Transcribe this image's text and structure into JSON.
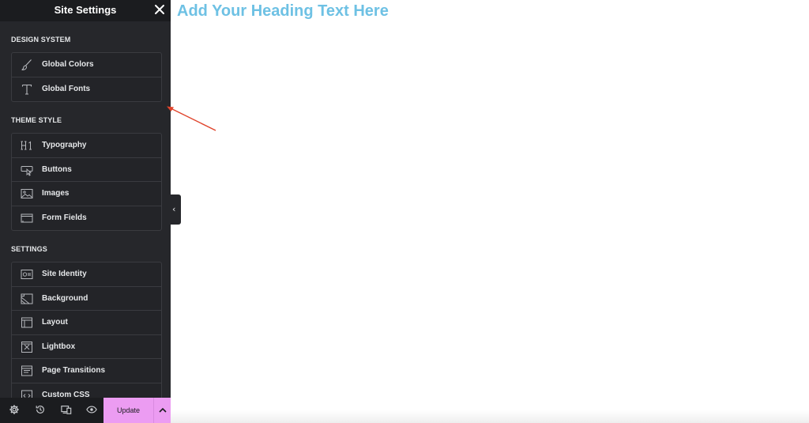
{
  "panel": {
    "title": "Site Settings",
    "close_icon": "close-icon"
  },
  "sections": [
    {
      "title": "DESIGN SYSTEM",
      "items": [
        {
          "label": "Global Colors",
          "icon": "brush-icon"
        },
        {
          "label": "Global Fonts",
          "icon": "type-t-icon"
        }
      ]
    },
    {
      "title": "THEME STYLE",
      "items": [
        {
          "label": "Typography",
          "icon": "h1-icon"
        },
        {
          "label": "Buttons",
          "icon": "button-cursor-icon"
        },
        {
          "label": "Images",
          "icon": "image-icon"
        },
        {
          "label": "Form Fields",
          "icon": "form-field-icon"
        }
      ]
    },
    {
      "title": "SETTINGS",
      "items": [
        {
          "label": "Site Identity",
          "icon": "site-identity-icon"
        },
        {
          "label": "Background",
          "icon": "background-icon"
        },
        {
          "label": "Layout",
          "icon": "layout-icon"
        },
        {
          "label": "Lightbox",
          "icon": "lightbox-icon"
        },
        {
          "label": "Page Transitions",
          "icon": "page-transitions-icon"
        },
        {
          "label": "Custom CSS",
          "icon": "code-icon"
        }
      ]
    }
  ],
  "footer": {
    "update_label": "Update",
    "icons": [
      "settings-icon",
      "history-icon",
      "responsive-icon",
      "preview-eye-icon",
      "chevron-up-icon"
    ]
  },
  "canvas": {
    "heading": "Add Your Heading Text Here"
  },
  "colors": {
    "panel_bg": "#26272b",
    "header_bg": "#1b1c1f",
    "accent_update": "#ec9cf2",
    "heading": "#6ec1e4",
    "annotation_arrow": "#e0442c"
  }
}
